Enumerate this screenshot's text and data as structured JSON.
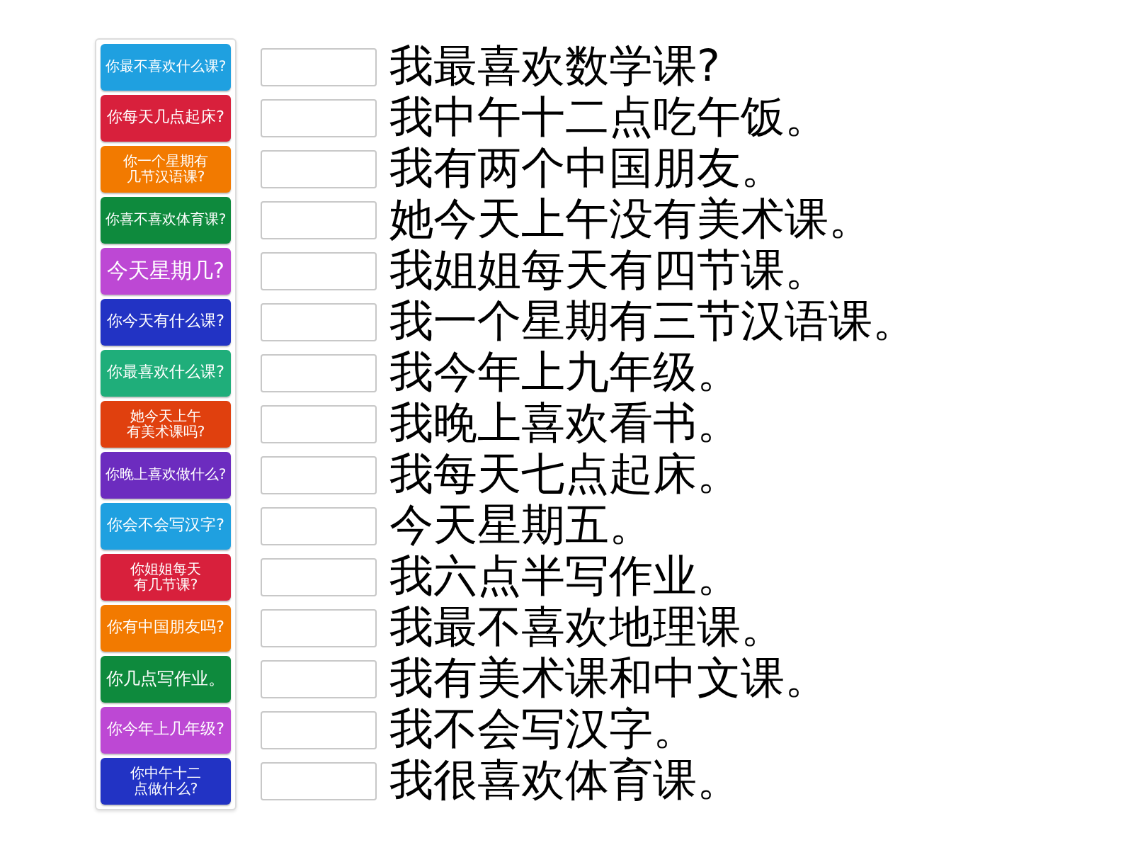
{
  "tiles": [
    {
      "text": "你最不喜欢什么课?",
      "color": "#1fa0e0"
    },
    {
      "text": "你每天几点起床?",
      "color": "#d8203c"
    },
    {
      "text": "你一个星期有几节汉语课?",
      "color": "#f27a00"
    },
    {
      "text": "你喜不喜欢体育课?",
      "color": "#0e8a3d"
    },
    {
      "text": "今天星期几?",
      "color": "#bd48d4"
    },
    {
      "text": "你今天有什么课?",
      "color": "#2233c4"
    },
    {
      "text": "你最喜欢什么课?",
      "color": "#1fae7a"
    },
    {
      "text": "她今天上午有美术课吗?",
      "color": "#e0400e"
    },
    {
      "text": "你晚上喜欢做什么?",
      "color": "#6c2cbf"
    },
    {
      "text": "你会不会写汉字?",
      "color": "#1fa0e0"
    },
    {
      "text": "你姐姐每天有几节课?",
      "color": "#d8203c"
    },
    {
      "text": "你有中国朋友吗?",
      "color": "#f27a00"
    },
    {
      "text": "你几点写作业。",
      "color": "#0e8a3d"
    },
    {
      "text": "你今年上几年级?",
      "color": "#bd48d4"
    },
    {
      "text": "你中午十二点做什么?",
      "color": "#2233c4"
    }
  ],
  "rows": [
    {
      "sentence": "我最喜欢数学课?"
    },
    {
      "sentence": "我中午十二点吃午饭。"
    },
    {
      "sentence": "我有两个中国朋友。"
    },
    {
      "sentence": "她今天上午没有美术课。"
    },
    {
      "sentence": "我姐姐每天有四节课。"
    },
    {
      "sentence": "我一个星期有三节汉语课。"
    },
    {
      "sentence": "我今年上九年级。"
    },
    {
      "sentence": "我晚上喜欢看书。"
    },
    {
      "sentence": "我每天七点起床。"
    },
    {
      "sentence": "今天星期五。"
    },
    {
      "sentence": "我六点半写作业。"
    },
    {
      "sentence": "我最不喜欢地理课。"
    },
    {
      "sentence": "我有美术课和中文课。"
    },
    {
      "sentence": "我不会写汉字。"
    },
    {
      "sentence": "我很喜欢体育课。"
    }
  ]
}
